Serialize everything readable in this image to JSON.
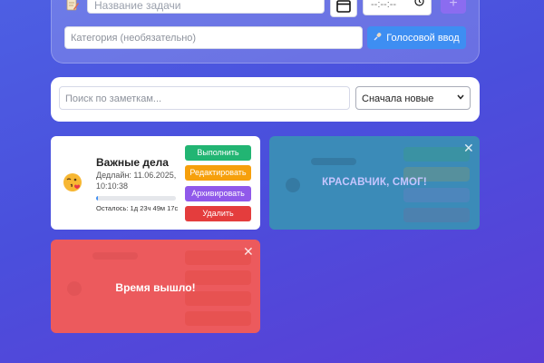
{
  "add_task": {
    "title_placeholder": "Название задачи",
    "time_placeholder": "--:--:--",
    "add_label": "+",
    "category_placeholder": "Категория (необязательно)",
    "voice_label": "Голосовой ввод"
  },
  "search": {
    "placeholder": "Поиск по заметкам...",
    "sort_value": "Сначала новые"
  },
  "task": {
    "title": "Важные дела",
    "deadline": "Дедлайн: 11.06.2025, 10:10:38",
    "remaining": "Осталось: 1д 23ч 49м 17с",
    "progress": 0.02,
    "buttons": {
      "complete": "Выполнить",
      "edit": "Редактировать",
      "archive": "Архивировать",
      "delete": "Удалить"
    }
  },
  "success_overlay": {
    "message": "КРАСАВЧИК, СМОГ!",
    "close": "✕"
  },
  "expired_overlay": {
    "message": "Время вышло!",
    "close": "✕"
  },
  "colors": {
    "complete": "#22b573",
    "edit": "#f6a00c",
    "archive": "#9059ea",
    "delete": "#e43d3d",
    "accent": "#3e8ef2"
  }
}
